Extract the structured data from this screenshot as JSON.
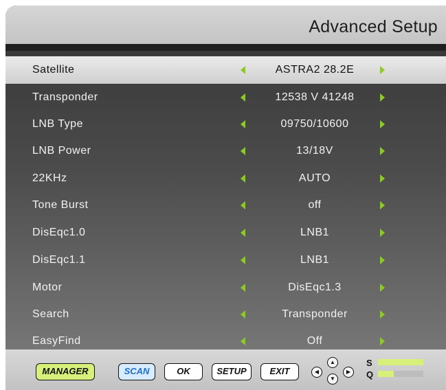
{
  "header": {
    "title": "Advanced Setup"
  },
  "rows": [
    {
      "label": "Satellite",
      "value": "ASTRA2 28.2E",
      "selected": true
    },
    {
      "label": "Transponder",
      "value": "12538 V 41248"
    },
    {
      "label": "LNB Type",
      "value": "09750/10600"
    },
    {
      "label": "LNB Power",
      "value": "13/18V"
    },
    {
      "label": "22KHz",
      "value": "AUTO"
    },
    {
      "label": "Tone Burst",
      "value": "off"
    },
    {
      "label": "DisEqc1.0",
      "value": "LNB1"
    },
    {
      "label": "DisEqc1.1",
      "value": "LNB1"
    },
    {
      "label": "Motor",
      "value": "DisEqc1.3"
    },
    {
      "label": "Search",
      "value": "Transponder"
    },
    {
      "label": "EasyFind",
      "value": "Off"
    }
  ],
  "footer": {
    "buttons": {
      "manager": "MANAGER",
      "scan": "SCAN",
      "ok": "OK",
      "setup": "SETUP",
      "exit": "EXIT"
    },
    "nav_icons": [
      "arrow-left-key-icon",
      "arrow-up-key-icon",
      "arrow-down-key-icon",
      "arrow-right-key-icon"
    ],
    "signal": {
      "strength_label": "S",
      "quality_label": "Q",
      "strength_fraction": 1.0,
      "quality_fraction": 0.35
    }
  },
  "colors": {
    "arrow": "#8ccc1e",
    "manager_button": "#d7f07a",
    "scan_text": "#1f6ec9",
    "signal_fill": "#d7f07a"
  }
}
